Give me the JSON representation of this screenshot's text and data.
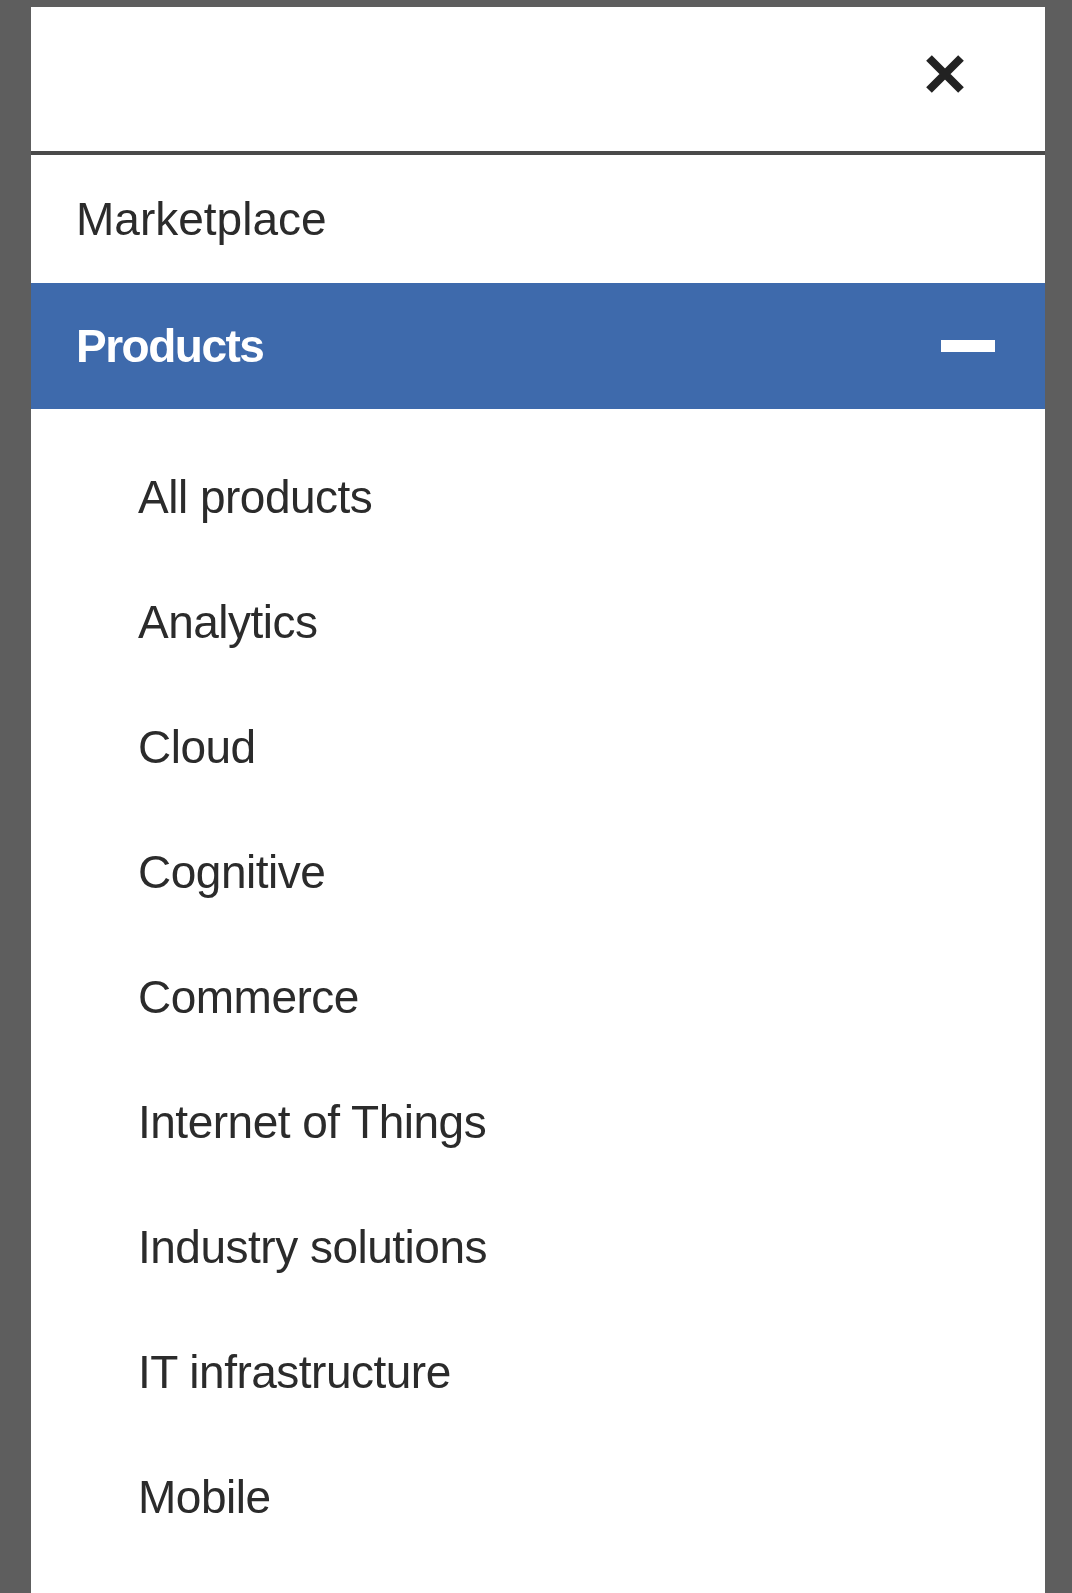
{
  "menu": {
    "items": [
      {
        "kind": "link",
        "label": "Marketplace"
      },
      {
        "kind": "group",
        "label": "Products",
        "expanded": true,
        "children": [
          {
            "label": "All products"
          },
          {
            "label": "Analytics"
          },
          {
            "label": "Cloud"
          },
          {
            "label": "Cognitive"
          },
          {
            "label": "Commerce"
          },
          {
            "label": "Internet of Things"
          },
          {
            "label": "Industry solutions"
          },
          {
            "label": "IT infrastructure"
          },
          {
            "label": "Mobile"
          }
        ]
      }
    ]
  }
}
